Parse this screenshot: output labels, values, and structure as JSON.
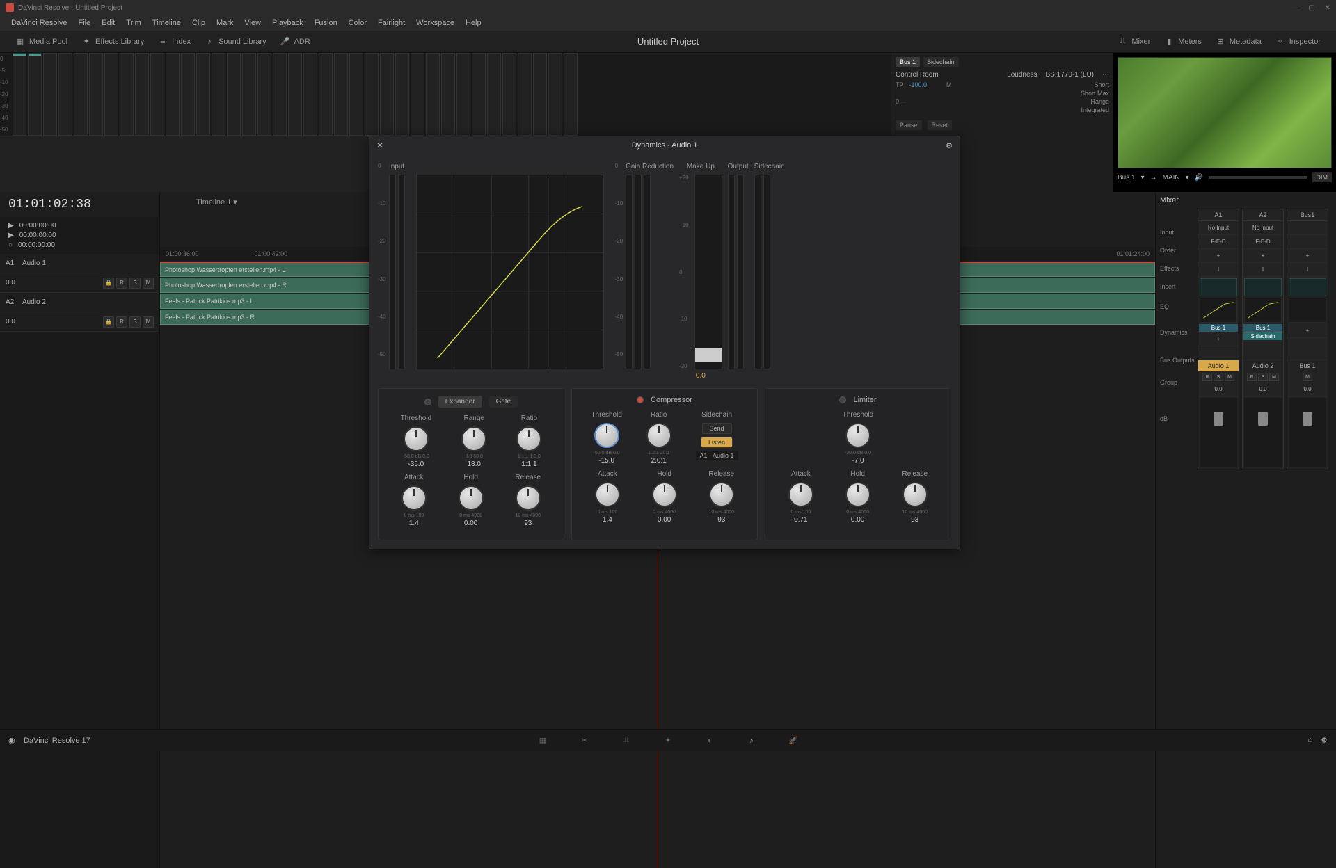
{
  "titlebar": {
    "text": "DaVinci Resolve - Untitled Project"
  },
  "menu": [
    "DaVinci Resolve",
    "File",
    "Edit",
    "Trim",
    "Timeline",
    "Clip",
    "Mark",
    "View",
    "Playback",
    "Fusion",
    "Color",
    "Fairlight",
    "Workspace",
    "Help"
  ],
  "toolbar": {
    "media_pool": "Media Pool",
    "effects": "Effects Library",
    "index": "Index",
    "sound": "Sound Library",
    "adr": "ADR",
    "mixer": "Mixer",
    "meters": "Meters",
    "metadata": "Metadata",
    "inspector": "Inspector"
  },
  "project_title": "Untitled Project",
  "control_room": {
    "bus1": "Bus 1",
    "sidechain": "Sidechain",
    "title": "Control Room",
    "tp": "TP",
    "tp_val": "-100.0",
    "m": "M",
    "loudness": "Loudness",
    "loudness_spec": "BS.1770-1 (LU)",
    "short": "Short",
    "short_max": "Short Max",
    "range": "Range",
    "integrated": "Integrated",
    "pause": "Pause",
    "reset": "Reset"
  },
  "preview": {
    "bus": "Bus 1",
    "main": "MAIN",
    "dim": "DIM"
  },
  "timecode": "01:01:02:38",
  "timeline_name": "Timeline 1",
  "transport": {
    "t1": "00:00:00:00",
    "t2": "00:00:00:00",
    "t3": "00:00:00:00"
  },
  "ruler": {
    "m1": "01:00:36:00",
    "m2": "01:00:42:00",
    "m3": "01:01:24:00"
  },
  "tracks": [
    {
      "id": "A1",
      "name": "Audio 1",
      "val": "0.0"
    },
    {
      "id": "A2",
      "name": "Audio 2",
      "val": "0.0"
    }
  ],
  "clips": {
    "a1l": "Photoshop Wassertropfen erstellen.mp4 - L",
    "a1r": "Photoshop Wassertropfen erstellen.mp4 - R",
    "a2l": "Feels - Patrick Patrikios.mp3 - L",
    "a2r": "Feels - Patrick Patrikios.mp3 - R"
  },
  "dialog": {
    "title": "Dynamics - Audio 1",
    "input": "Input",
    "gain_reduction": "Gain Reduction",
    "make_up": "Make Up",
    "output": "Output",
    "sidechain": "Sidechain",
    "makeup_val": "0.0",
    "expander": {
      "tab1": "Expander",
      "tab2": "Gate",
      "threshold": "Threshold",
      "threshold_range": "-50.0 dB  0.0",
      "threshold_val": "-35.0",
      "range": "Range",
      "range_range": "0.0    60.0",
      "range_val": "18.0",
      "ratio": "Ratio",
      "ratio_range": "1:1.1    1:3.0",
      "ratio_val": "1:1.1",
      "attack": "Attack",
      "attack_range": "0 ms    100",
      "attack_val": "1.4",
      "hold": "Hold",
      "hold_range": "0 ms    4000",
      "hold_val": "0.00",
      "release": "Release",
      "release_range": "10 ms    4000",
      "release_val": "93"
    },
    "compressor": {
      "title": "Compressor",
      "threshold": "Threshold",
      "threshold_range": "-50.0 dB  0.0",
      "threshold_val": "-15.0",
      "ratio": "Ratio",
      "ratio_range": "1.2:1    20:1",
      "ratio_val": "2.0:1",
      "sidechain": "Sidechain",
      "send": "Send",
      "listen": "Listen",
      "source": "A1 - Audio 1",
      "attack": "Attack",
      "attack_range": "0 ms    100",
      "attack_val": "1.4",
      "hold": "Hold",
      "hold_range": "0 ms    4000",
      "hold_val": "0.00",
      "release": "Release",
      "release_range": "10 ms    4000",
      "release_val": "93"
    },
    "limiter": {
      "title": "Limiter",
      "threshold": "Threshold",
      "threshold_range": "-30.0 dB  0.0",
      "threshold_val": "-7.0",
      "attack": "Attack",
      "attack_range": "0 ms    100",
      "attack_val": "0.71",
      "hold": "Hold",
      "hold_range": "0 ms    4000",
      "hold_val": "0.00",
      "release": "Release",
      "release_range": "10 ms    4000",
      "release_val": "93"
    }
  },
  "mixer": {
    "title": "Mixer",
    "labels": {
      "input": "Input",
      "order": "Order",
      "effects": "Effects",
      "insert": "Insert",
      "eq": "EQ",
      "dynamics": "Dynamics",
      "bus_outputs": "Bus Outputs",
      "group": "Group",
      "db": "dB"
    },
    "strips": [
      {
        "id": "A1",
        "input": "No Input",
        "order": "F-E-D",
        "bus": "Bus 1",
        "name": "Audio 1",
        "db": "0.0"
      },
      {
        "id": "A2",
        "input": "No Input",
        "order": "F-E-D",
        "bus": "Bus 1",
        "sc": "Sidechain",
        "name": "Audio 2",
        "db": "0.0"
      },
      {
        "id": "Bus1",
        "input": "",
        "order": "",
        "name": "Bus 1",
        "db": "0.0"
      }
    ],
    "insert_i": "I",
    "plus": "+",
    "btns": [
      "R",
      "S",
      "M"
    ]
  },
  "footer": {
    "app": "DaVinci Resolve 17"
  }
}
